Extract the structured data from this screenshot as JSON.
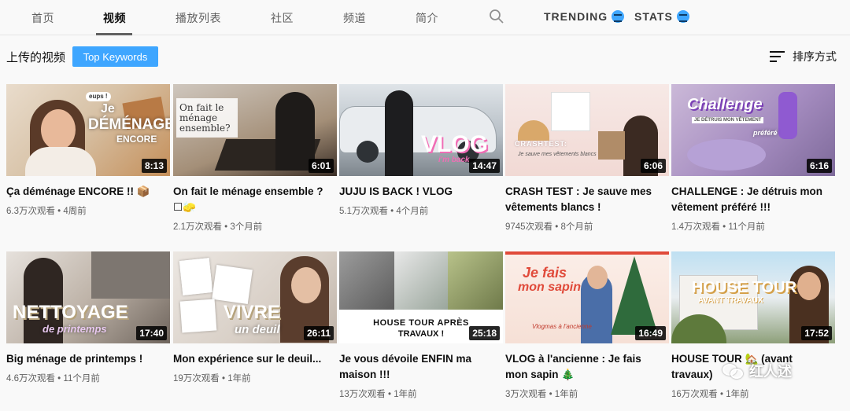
{
  "tabs": [
    {
      "label": "首页",
      "active": false
    },
    {
      "label": "视频",
      "active": true
    },
    {
      "label": "播放列表",
      "active": false
    },
    {
      "label": "社区",
      "active": false
    },
    {
      "label": "频道",
      "active": false
    },
    {
      "label": "简介",
      "active": false
    }
  ],
  "extensions": {
    "trending": "TRENDING",
    "stats": "STATS"
  },
  "section": {
    "title": "上传的视频",
    "keywords_button": "Top Keywords",
    "sort_label": "排序方式"
  },
  "videos": [
    {
      "title_line1": "Ça déménage ENCORE !! 📦",
      "title_line2": "",
      "meta": "6.3万次观看 • 4周前",
      "duration": "8:13",
      "thumb_lines": [
        "eups !",
        "Je",
        "DÉMÉNAGE",
        "ENCORE"
      ]
    },
    {
      "title_line1": "On fait le ménage ensemble ?",
      "title_line2": "☐🧽",
      "meta": "2.1万次观看 • 3个月前",
      "duration": "6:01",
      "thumb_lines": [
        "On fait le",
        "ménage",
        "ensemble?"
      ]
    },
    {
      "title_line1": "JUJU IS BACK ! VLOG",
      "title_line2": "",
      "meta": "5.1万次观看 • 4个月前",
      "duration": "14:47",
      "thumb_lines": [
        "VLOG",
        "i'm back"
      ]
    },
    {
      "title_line1": "CRASH TEST : Je sauve mes",
      "title_line2": "vêtements blancs !",
      "meta": "9745次观看 • 8个月前",
      "duration": "6:06",
      "thumb_lines": [
        "CRASHTEST:",
        "Je sauve mes vêtements blancs"
      ]
    },
    {
      "title_line1": "CHALLENGE : Je détruis mon",
      "title_line2": "vêtement préféré !!!",
      "meta": "1.4万次观看 • 11个月前",
      "duration": "6:16",
      "thumb_lines": [
        "Challenge",
        "JE DÉTRUIS MON VÊTEMENT",
        "préféré"
      ]
    },
    {
      "title_line1": "Big ménage de printemps !",
      "title_line2": "",
      "meta": "4.6万次观看 • 11个月前",
      "duration": "17:40",
      "thumb_lines": [
        "NETTOYAGE",
        "de printemps"
      ]
    },
    {
      "title_line1": "Mon expérience sur le deuil...",
      "title_line2": "",
      "meta": "19万次观看 • 1年前",
      "duration": "26:11",
      "thumb_lines": [
        "VIVRE",
        "un deuil"
      ]
    },
    {
      "title_line1": "Je vous dévoile ENFIN ma",
      "title_line2": "maison !!!",
      "meta": "13万次观看 • 1年前",
      "duration": "25:18",
      "thumb_lines": [
        "HOUSE TOUR APRÈS",
        "TRAVAUX !"
      ]
    },
    {
      "title_line1": "VLOG à l'ancienne : Je fais",
      "title_line2": "mon sapin 🎄",
      "meta": "3万次观看 • 1年前",
      "duration": "16:49",
      "thumb_lines": [
        "Je fais",
        "mon sapin",
        "Vlogmas à l'ancienne"
      ]
    },
    {
      "title_line1": "HOUSE TOUR 🏡 (avant",
      "title_line2": "travaux)",
      "meta": "16万次观看 • 1年前",
      "duration": "17:52",
      "thumb_lines": [
        "HOUSE TOUR",
        "AVANT TRAVAUX"
      ]
    }
  ],
  "watermark": "红人述",
  "colors": {
    "accent": "#3ea6ff",
    "meta": "#606060",
    "text": "#0f0f0f"
  }
}
